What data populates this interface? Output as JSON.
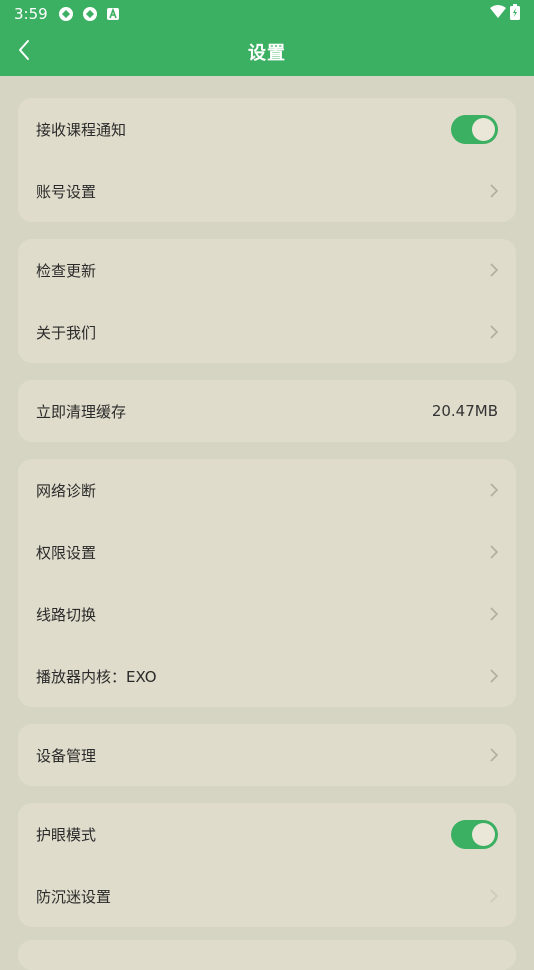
{
  "status_bar": {
    "time": "3:59"
  },
  "header": {
    "title": "设置"
  },
  "groups": [
    {
      "items": [
        {
          "label": "接收课程通知",
          "control": "toggle",
          "on": true
        },
        {
          "label": "账号设置",
          "control": "chevron"
        }
      ]
    },
    {
      "items": [
        {
          "label": "检查更新",
          "control": "chevron"
        },
        {
          "label": "关于我们",
          "control": "chevron"
        }
      ]
    },
    {
      "items": [
        {
          "label": "立即清理缓存",
          "control": "value",
          "value": "20.47MB"
        }
      ]
    },
    {
      "items": [
        {
          "label": "网络诊断",
          "control": "chevron"
        },
        {
          "label": "权限设置",
          "control": "chevron"
        },
        {
          "label": "线路切换",
          "control": "chevron"
        },
        {
          "label": "播放器内核：EXO",
          "control": "chevron"
        }
      ]
    },
    {
      "items": [
        {
          "label": "设备管理",
          "control": "chevron"
        }
      ]
    },
    {
      "items": [
        {
          "label": "护眼模式",
          "control": "toggle",
          "on": true
        },
        {
          "label": "防沉迷设置",
          "control": "chevron"
        }
      ]
    }
  ],
  "colors": {
    "accent": "#3cb062",
    "background": "#d6d5c3",
    "card": "#e0dccb"
  }
}
